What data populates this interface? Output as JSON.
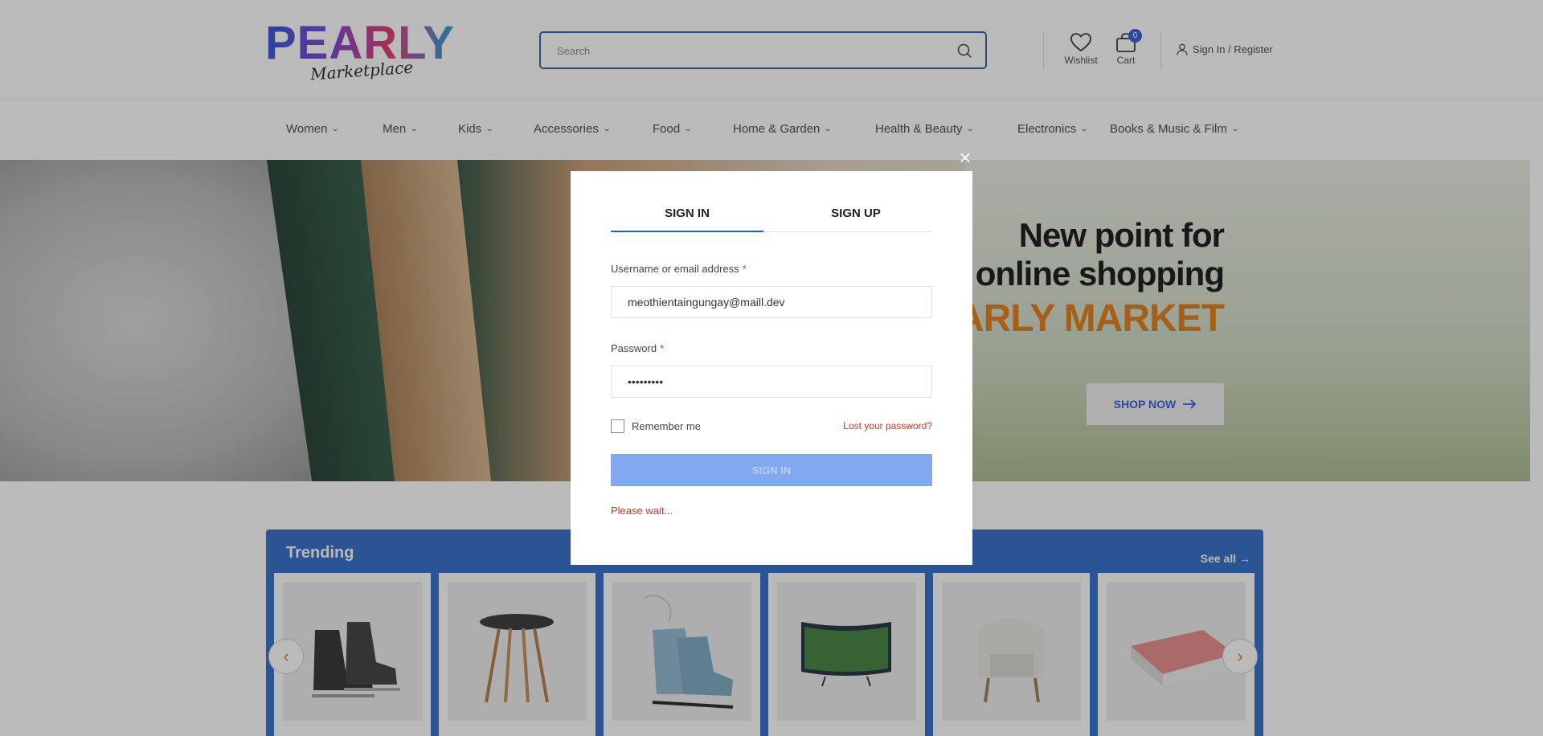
{
  "header": {
    "logo_main": "PEARLY",
    "logo_sub": "Marketplace",
    "search_placeholder": "Search",
    "wishlist_label": "Wishlist",
    "cart_label": "Cart",
    "cart_count": "0",
    "signin_label": "Sign In / Register"
  },
  "nav": {
    "items": [
      {
        "label": "Women"
      },
      {
        "label": "Men"
      },
      {
        "label": "Kids"
      },
      {
        "label": "Accessories"
      },
      {
        "label": "Food"
      },
      {
        "label": "Home & Garden"
      },
      {
        "label": "Health & Beauty"
      },
      {
        "label": "Electronics"
      },
      {
        "label": "Books & Music & Film"
      }
    ]
  },
  "hero": {
    "title_line1": "New point for",
    "title_line2": "online shopping",
    "brand": "ARLY MARKET",
    "cta": "SHOP NOW"
  },
  "trending": {
    "title": "Trending",
    "see_all": "See all →",
    "products": [
      {
        "icon": "hockey-skates"
      },
      {
        "icon": "side-table"
      },
      {
        "icon": "ice-skates"
      },
      {
        "icon": "curved-tv"
      },
      {
        "icon": "armchair"
      },
      {
        "icon": "power-bank"
      }
    ]
  },
  "modal": {
    "tab_signin": "SIGN IN",
    "tab_signup": "SIGN UP",
    "username_label": "Username or email address",
    "username_value": "meothientaingungay@maill.dev",
    "password_label": "Password",
    "password_value": "•••••••••",
    "required_mark": "*",
    "remember_label": "Remember me",
    "lost_password": "Lost your password?",
    "submit_label": "SIGN IN",
    "status": "Please wait..."
  },
  "colors": {
    "accent": "#2a5bd7",
    "brand_orange": "#e07a10",
    "error": "#c0392b",
    "trending_bg": "#2c69c7"
  }
}
